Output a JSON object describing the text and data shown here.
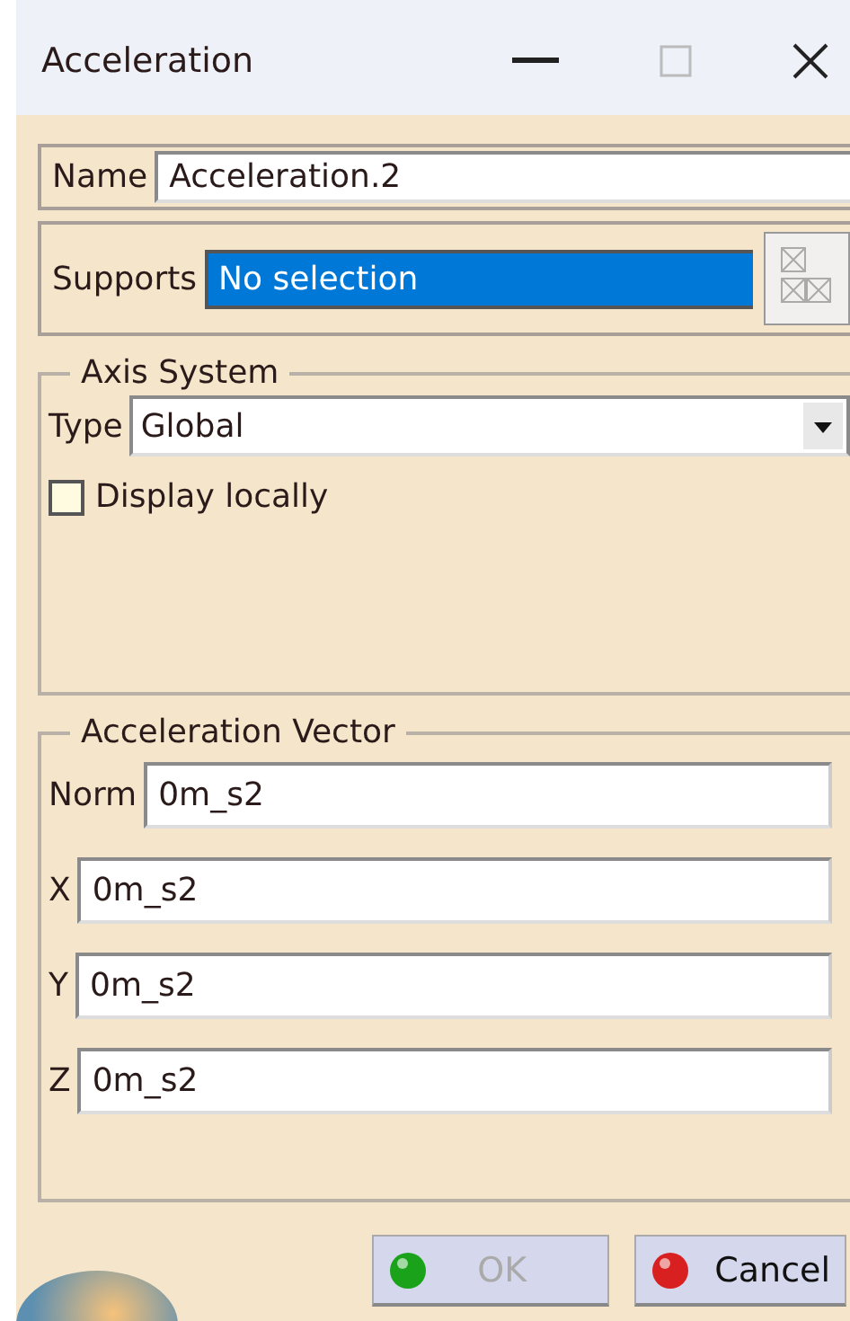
{
  "window": {
    "title": "Acceleration"
  },
  "name_field": {
    "label": "Name",
    "value": "Acceleration.2"
  },
  "supports_field": {
    "label": "Supports",
    "value": "No selection",
    "selected": true
  },
  "axis_system": {
    "title": "Axis System",
    "type_label": "Type",
    "type_value": "Global",
    "display_locally": {
      "label": "Display locally",
      "checked": false
    }
  },
  "acceleration_vector": {
    "title": "Acceleration Vector",
    "fields": [
      {
        "label": "Norm",
        "value": "0m_s2"
      },
      {
        "label": "X",
        "value": "0m_s2"
      },
      {
        "label": "Y",
        "value": "0m_s2"
      },
      {
        "label": "Z",
        "value": "0m_s2"
      }
    ]
  },
  "buttons": [
    {
      "label": "OK",
      "kind": "ok",
      "disabled": true
    },
    {
      "label": "Cancel",
      "kind": "cancel",
      "disabled": false
    }
  ]
}
